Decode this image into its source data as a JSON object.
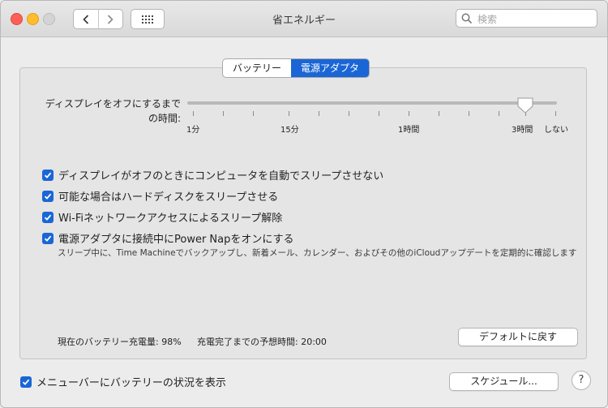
{
  "window": {
    "title": "省エネルギー"
  },
  "toolbar": {
    "search_placeholder": "検索"
  },
  "tabs": [
    {
      "label": "バッテリー",
      "active": false
    },
    {
      "label": "電源アダプタ",
      "active": true
    }
  ],
  "slider": {
    "label_line1": "ディスプレイをオフにするまで",
    "label_line2": "の時間:",
    "tick_labels": [
      "1分",
      "15分",
      "1時間",
      "3時間",
      "しない"
    ],
    "value": "3時間"
  },
  "options": [
    {
      "label": "ディスプレイがオフのときにコンピュータを自動でスリープさせない",
      "checked": true
    },
    {
      "label": "可能な場合はハードディスクをスリープさせる",
      "checked": true
    },
    {
      "label": "Wi-Fiネットワークアクセスによるスリープ解除",
      "checked": true
    },
    {
      "label": "電源アダプタに接続中にPower Napをオンにする",
      "checked": true
    }
  ],
  "power_nap_note": "スリープ中に、Time Machineでバックアップし、新着メール、カレンダー、およびその他のiCloudアップデートを定期的に確認します",
  "status": {
    "battery_charge": "現在のバッテリー充電量: 98%",
    "time_to_full": "充電完了までの予想時間: 20:00"
  },
  "buttons": {
    "restore_defaults": "デフォルトに戻す",
    "schedule": "スケジュール...",
    "help": "?"
  },
  "menubar_option": {
    "label": "メニューバーにバッテリーの状況を表示",
    "checked": true
  },
  "colors": {
    "accent": "#1a66d6"
  }
}
